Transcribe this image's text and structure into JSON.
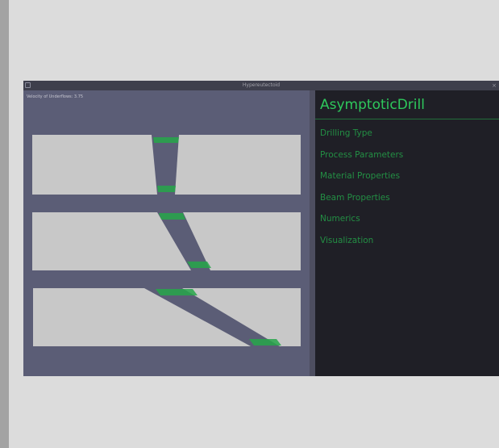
{
  "window": {
    "title": "Hypereutectoid",
    "close_glyph": "×"
  },
  "viewport": {
    "caption": "Velocity of Underflows: 3.75"
  },
  "panel": {
    "title": "AsymptoticDrill",
    "menu_items": [
      "Drilling Type",
      "Process Parameters",
      "Material Properties",
      "Beam Properties",
      "Numerics",
      "Visualization"
    ]
  },
  "colors": {
    "background": "#dcdcdc",
    "viewport": "#5b5d76",
    "slab": "#c8c8c8",
    "panel": "#1f1f26",
    "accent_green": "#2ec85c",
    "menu_green": "#238f44",
    "marker_green": "#27a64a"
  },
  "icons": [
    "window-icon",
    "close-icon"
  ]
}
